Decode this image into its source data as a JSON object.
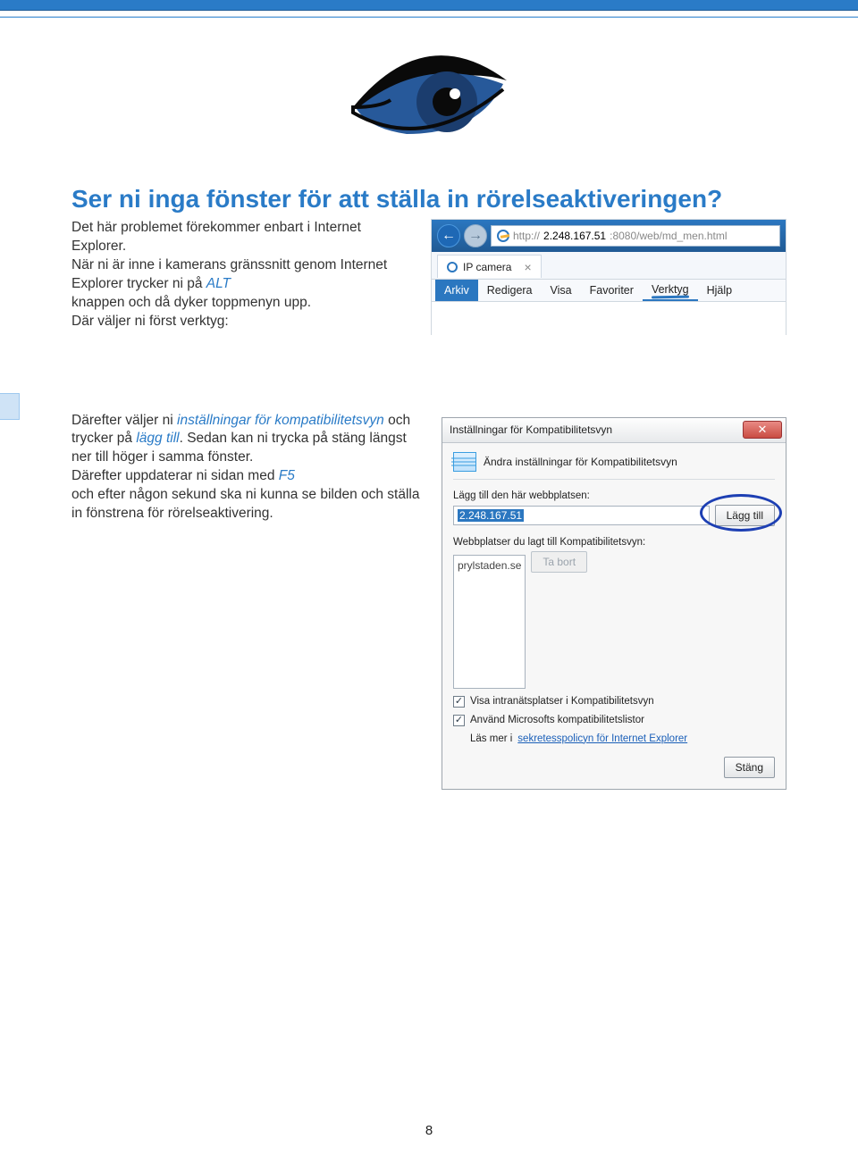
{
  "header": {},
  "logo": {
    "aria": "eye-logo"
  },
  "heading": "Ser ni inga fönster för att ställa in rörelseaktiveringen?",
  "p1": {
    "l1": "Det här problemet förekommer enbart i Internet Explorer.",
    "l2a": "När ni är inne i kamerans gränssnitt genom Internet Explorer trycker ni på ",
    "alt": "ALT",
    "l3": "knappen och då dyker toppmenyn upp.",
    "l4": "Där väljer ni först verktyg:"
  },
  "ie": {
    "url_pre": "http://",
    "url_ip": "2.248.167.51",
    "url_post": ":8080/web/md_men.html",
    "tab_title": "IP camera",
    "menu": [
      "Arkiv",
      "Redigera",
      "Visa",
      "Favoriter",
      "Verktyg",
      "Hjälp"
    ]
  },
  "p2": {
    "a": "Därefter väljer ni ",
    "link1": "inställningar för kompatibilitetsvyn",
    "b": " och trycker på ",
    "link2": "lägg till",
    "c": ". Sedan kan ni trycka på stäng längst ner till höger i samma fönster.",
    "d": "Därefter uppdaterar ni sidan med ",
    "f5": "F5",
    "e": "och efter någon sekund ska ni kunna se bilden och ställa in fönstrena för rörelseaktivering."
  },
  "compat": {
    "title": "Inställningar för Kompatibilitetsvyn",
    "subtitle": "Ändra inställningar för Kompatibilitetsvyn",
    "add_label": "Lägg till den här webbplatsen:",
    "add_value": "2.248.167.51",
    "add_btn": "Lägg till",
    "list_label": "Webbplatser du lagt till Kompatibilitetsvyn:",
    "list_item": "prylstaden.se",
    "remove_btn": "Ta bort",
    "chk1": "Visa intranätsplatser i Kompatibilitetsvyn",
    "chk2": "Använd Microsofts kompatibilitetslistor",
    "more_pre": "Läs mer i ",
    "more_link": "sekretesspolicyn för Internet Explorer",
    "close_btn": "Stäng"
  },
  "page_number": "8"
}
